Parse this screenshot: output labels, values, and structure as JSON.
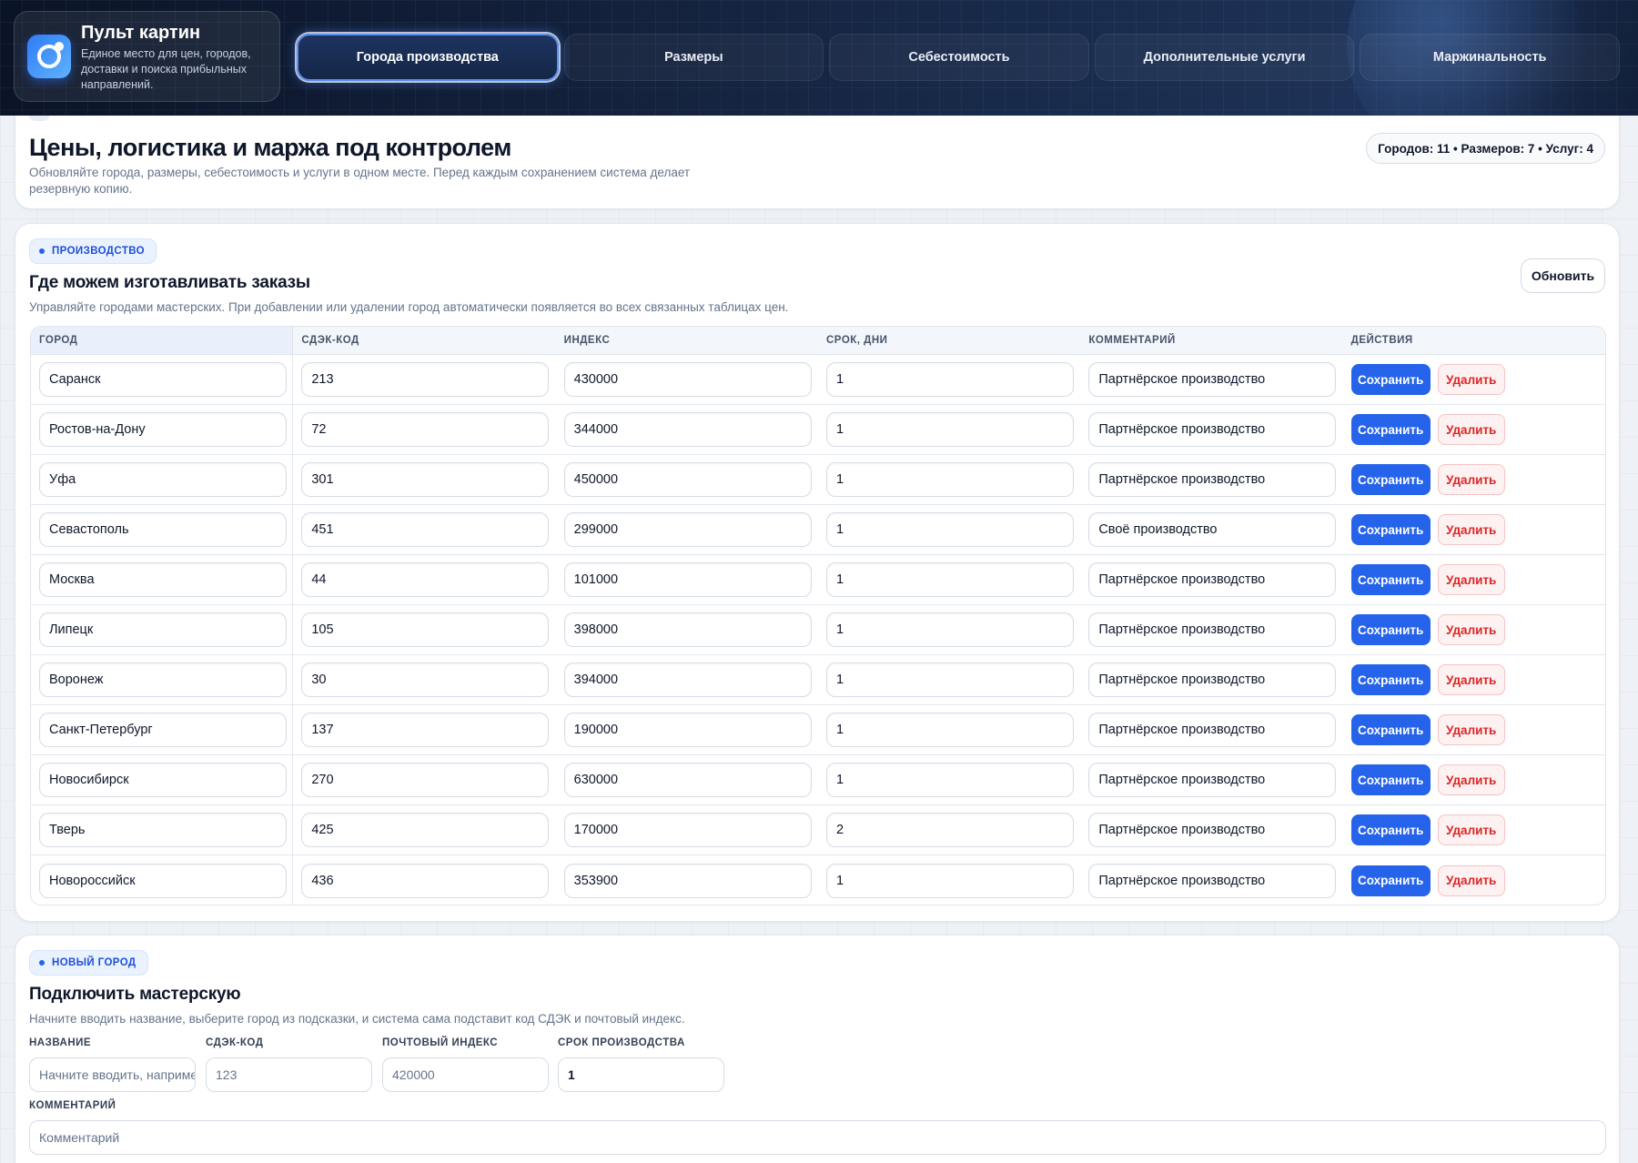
{
  "brand": {
    "title": "Пульт картин",
    "subtitle": "Единое место для цен, городов, доставки и поиска прибыльных направлений."
  },
  "tabs": [
    {
      "label": "Города производства",
      "active": true
    },
    {
      "label": "Размеры",
      "active": false
    },
    {
      "label": "Себестоимость",
      "active": false
    },
    {
      "label": "Дополнительные услуги",
      "active": false
    },
    {
      "label": "Маржинальность",
      "active": false
    }
  ],
  "overview": {
    "title": "Цены, логистика и маржа под контролем",
    "description": "Обновляйте города, размеры, себестоимость и услуги в одном месте. Перед каждым сохранением система делает резервную копию.",
    "stats": "Городов: 11 • Размеров: 7 • Услуг: 4"
  },
  "production": {
    "badge": "ПРОИЗВОДСТВО",
    "title": "Где можем изготавливать заказы",
    "description": "Управляйте городами мастерских. При добавлении или удалении город автоматически появляется во всех связанных таблицах цен.",
    "refresh_label": "Обновить",
    "columns": [
      "ГОРОД",
      "СДЭК-КОД",
      "ИНДЕКС",
      "СРОК, ДНИ",
      "КОММЕНТАРИЙ",
      "ДЕЙСТВИЯ"
    ],
    "save_label": "Сохранить",
    "delete_label": "Удалить",
    "rows": [
      {
        "city": "Саранск",
        "cdek": "213",
        "index": "430000",
        "days": "1",
        "comment": "Партнёрское производство"
      },
      {
        "city": "Ростов-на-Дону",
        "cdek": "72",
        "index": "344000",
        "days": "1",
        "comment": "Партнёрское производство"
      },
      {
        "city": "Уфа",
        "cdek": "301",
        "index": "450000",
        "days": "1",
        "comment": "Партнёрское производство"
      },
      {
        "city": "Севастополь",
        "cdek": "451",
        "index": "299000",
        "days": "1",
        "comment": "Своё производство"
      },
      {
        "city": "Москва",
        "cdek": "44",
        "index": "101000",
        "days": "1",
        "comment": "Партнёрское производство"
      },
      {
        "city": "Липецк",
        "cdek": "105",
        "index": "398000",
        "days": "1",
        "comment": "Партнёрское производство"
      },
      {
        "city": "Воронеж",
        "cdek": "30",
        "index": "394000",
        "days": "1",
        "comment": "Партнёрское производство"
      },
      {
        "city": "Санкт-Петербург",
        "cdek": "137",
        "index": "190000",
        "days": "1",
        "comment": "Партнёрское производство"
      },
      {
        "city": "Новосибирск",
        "cdek": "270",
        "index": "630000",
        "days": "1",
        "comment": "Партнёрское производство"
      },
      {
        "city": "Тверь",
        "cdek": "425",
        "index": "170000",
        "days": "2",
        "comment": "Партнёрское производство"
      },
      {
        "city": "Новороссийск",
        "cdek": "436",
        "index": "353900",
        "days": "1",
        "comment": "Партнёрское производство"
      }
    ]
  },
  "new_city": {
    "badge": "НОВЫЙ ГОРОД",
    "title": "Подключить мастерскую",
    "description": "Начните вводить название, выберите город из подсказки, и система сама подставит код СДЭК и почтовый индекс.",
    "name_label": "НАЗВАНИЕ",
    "name_placeholder": "Начните вводить, например",
    "cdek_label": "СДЭК-КОД",
    "cdek_placeholder": "123",
    "index_label": "ПОЧТОВЫЙ ИНДЕКС",
    "index_placeholder": "420000",
    "days_label": "СРОК ПРОИЗВОДСТВА",
    "days_value": "1",
    "comment_label": "КОММЕНТАРИЙ",
    "comment_placeholder": "Комментарий"
  }
}
